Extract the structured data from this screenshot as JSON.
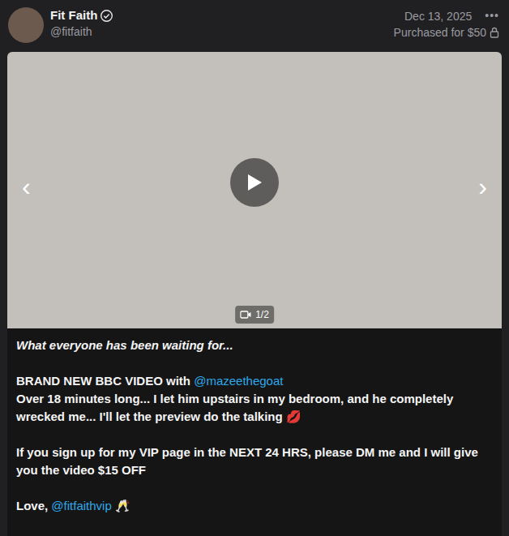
{
  "post": {
    "author": {
      "name": "Fit Faith",
      "handle": "@fitfaith",
      "verified": true
    },
    "date": "Dec 13, 2025",
    "menu": "•••",
    "purchase": "Purchased for $50",
    "media": {
      "prev": "‹",
      "next": "›",
      "counter": "1/2"
    },
    "caption": [
      {
        "italic": true,
        "lines": [
          [
            {
              "kind": "text",
              "text": "What everyone has been waiting for..."
            }
          ]
        ]
      },
      {
        "italic": false,
        "lines": [
          [
            {
              "kind": "text",
              "text": "BRAND NEW BBC VIDEO with "
            },
            {
              "kind": "mention",
              "text": "@mazeethegoat"
            }
          ],
          [
            {
              "kind": "text",
              "text": "Over 18 minutes long... I let him upstairs in my bedroom, and he completely wrecked me... I'll let the preview do the talking 💋"
            }
          ]
        ]
      },
      {
        "italic": false,
        "lines": [
          [
            {
              "kind": "text",
              "text": "If you sign up for my VIP page in the NEXT 24 HRS, please DM me and I will give you the video $15 OFF"
            }
          ]
        ]
      },
      {
        "italic": false,
        "lines": [
          [
            {
              "kind": "text",
              "text": "Love, "
            },
            {
              "kind": "mention",
              "text": "@fitfaithvip"
            },
            {
              "kind": "text",
              "text": " 🥂"
            }
          ]
        ]
      }
    ]
  }
}
